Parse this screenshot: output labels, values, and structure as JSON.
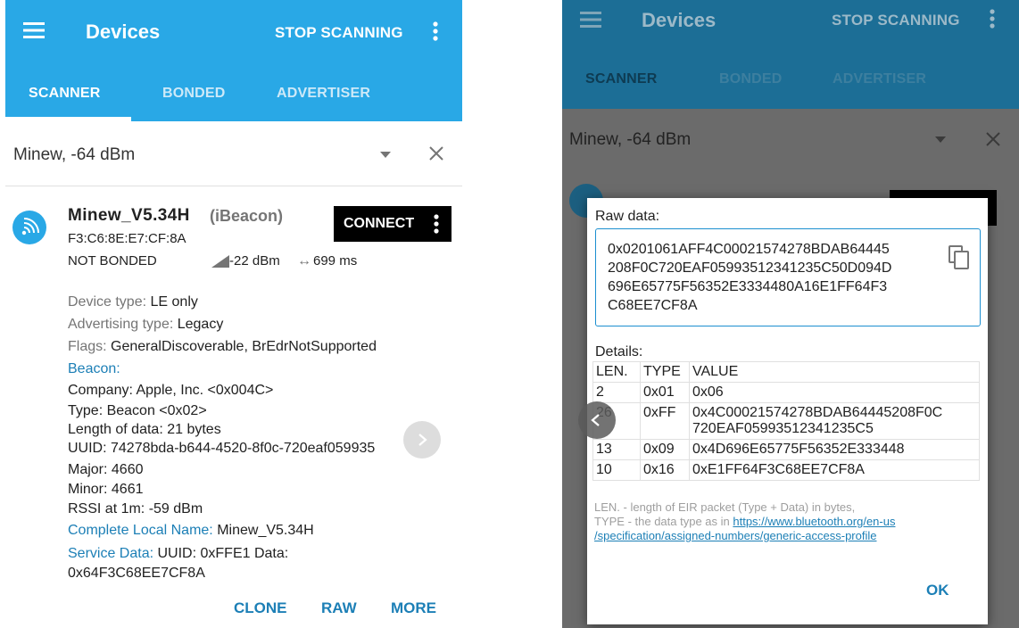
{
  "colors": {
    "primary": "#29a8e6",
    "primary_dark": "#1c6e96",
    "accent": "#1c7fb6",
    "connect_bg": "#000000"
  },
  "appbar": {
    "title": "Devices",
    "stop_label": "STOP SCANNING"
  },
  "tabs": [
    {
      "label": "SCANNER",
      "active": true
    },
    {
      "label": "BONDED",
      "active": false
    },
    {
      "label": "ADVERTISER",
      "active": false
    }
  ],
  "filter": {
    "value": "Minew, -64 dBm"
  },
  "device": {
    "name": "Minew_V5.34H",
    "type": "(iBeacon)",
    "address": "F3:C6:8E:E7:CF:8A",
    "bond_state": "NOT BONDED",
    "rssi": "-22 dBm",
    "interval": "699 ms",
    "connect_label": "CONNECT",
    "details": {
      "device_type_label": "Device type:",
      "device_type_value": "LE only",
      "adv_type_label": "Advertising type:",
      "adv_type_value": "Legacy",
      "flags_label": "Flags:",
      "flags_value": "GeneralDiscoverable, BrEdrNotSupported",
      "beacon_label": "Beacon:",
      "company": "Company: Apple, Inc. <0x004C>",
      "type": "Type: Beacon <0x02>",
      "length": "Length of data: 21 bytes",
      "uuid": "UUID: 74278bda-b644-4520-8f0c-720eaf059935",
      "major": "Major: 4660",
      "minor": "Minor: 4661",
      "rssi_1m": "RSSI at 1m: -59 dBm",
      "local_name_label": "Complete Local Name:",
      "local_name_value": "Minew_V5.34H",
      "service_data_label": "Service Data:",
      "service_data_value": "UUID: 0xFFE1 Data:",
      "service_data_value2": "0x64F3C68EE7CF8A"
    },
    "actions": {
      "clone": "CLONE",
      "raw": "RAW",
      "more": "MORE"
    }
  },
  "dialog": {
    "raw_label": "Raw data:",
    "raw_lines": [
      "0x0201061AFF4C00021574278BDAB64445",
      "208F0C720EAF05993512341235C50D094D",
      "696E65775F56352E3334480A16E1FF64F3",
      "C68EE7CF8A"
    ],
    "details_label": "Details:",
    "columns": [
      "LEN.",
      "TYPE",
      "VALUE"
    ],
    "rows": [
      {
        "len": "2",
        "type": "0x01",
        "value": "0x06",
        "value2": ""
      },
      {
        "len": "26",
        "type": "0xFF",
        "value": "0x4C00021574278BDAB64445208F0C",
        "value2": "720EAF05993512341235C5"
      },
      {
        "len": "13",
        "type": "0x09",
        "value": "0x4D696E65775F56352E333448",
        "value2": ""
      },
      {
        "len": "10",
        "type": "0x16",
        "value": "0xE1FF64F3C68EE7CF8A",
        "value2": ""
      }
    ],
    "note_line1": "LEN. - length of EIR packet (Type + Data) in bytes,",
    "note_line2_prefix": "TYPE - the data type as in ",
    "note_link1": "https://www.bluetooth.org/en-us",
    "note_link2": "/specification/assigned-numbers/generic-access-profile",
    "ok_label": "OK"
  }
}
